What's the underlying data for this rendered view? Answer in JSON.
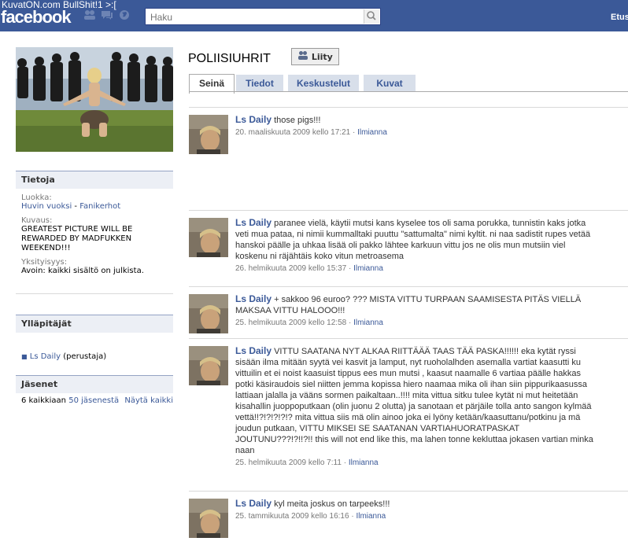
{
  "watermark": "KuvatON.com BullShit!1 >:[",
  "logo": "facebook",
  "search": {
    "placeholder": "Haku"
  },
  "top_right": "Etus",
  "group": {
    "title": "POLIISIUHRIT",
    "join_label": "Liity"
  },
  "tabs": [
    {
      "label": "Seinä"
    },
    {
      "label": "Tiedot"
    },
    {
      "label": "Keskustelut"
    },
    {
      "label": "Kuvat"
    }
  ],
  "info": {
    "header": "Tietoja",
    "category_label": "Luokka:",
    "category_value_1": "Huvin vuoksi",
    "category_sep": " - ",
    "category_value_2": "Fanikerhot",
    "desc_label": "Kuvaus:",
    "desc_value": "GREATEST PICTURE WILL BE REWARDED BY MADFUKKEN WEEKEND!!!",
    "privacy_label": "Yksityisyys:",
    "privacy_value": "Avoin: kaikki sisältö on julkista."
  },
  "admins": {
    "header": "Ylläpitäjät",
    "name": "Ls Daily",
    "role": "(perustaja)"
  },
  "members": {
    "header": "Jäsenet",
    "count_prefix": "6 kaikkiaan",
    "count_link": "50 jäsenestä",
    "show_all": "Näytä kaikki"
  },
  "posts": [
    {
      "author": "Ls Daily",
      "text": "those pigs!!!",
      "date": "20. maaliskuuta 2009 kello 17:21",
      "sep": " · ",
      "report": "Ilmianna"
    },
    {
      "author": "Ls Daily",
      "text": "paranee vielä, käytii mutsi kans kyselee tos oli sama porukka, tunnistin kaks jotka veti mua pataa, ni nimii kummalltaki puuttu \"sattumalta\" nimi kyltit. ni naa sadistit rupes vetää hanskoi päälle ja uhkaa lisää oli pakko lähtee karkuun vittu jos ne olis mun mutsiin viel koskenu ni räjähtäis koko vitun metroasema",
      "date": "26. helmikuuta 2009 kello 15:37",
      "sep": " · ",
      "report": "Ilmianna"
    },
    {
      "author": "Ls Daily",
      "text": "+ sakkoo 96 euroo? ??? MISTA VITTU TURPAAN SAAMISESTA PITÄS VIELLÄ MAKSAA VITTU HALOOO!!!",
      "date": "25. helmikuuta 2009 kello 12:58",
      "sep": " · ",
      "report": "Ilmianna"
    },
    {
      "author": "Ls Daily",
      "text": "VITTU SAATANA NYT ALKAA RIITTÄÄÄ TAAS TÄÄ PASKA!!!!!! eka kytät ryssi sisään ilma mitään syytä vei kasvit ja lamput, nyt ruoholalhden asemalla vartiat kaasutti ku vittuilin et ei noist kaasuist tippus ees mun mutsi , kaasut naamalle 6 vartiaa päälle hakkas potki käsiraudois siel niitten jemma kopissa hiero naamaa mika oli ihan siin pippurikaasussa lattiaan jalalla ja vääns sormen paikaltaan..!!!! mita vittua sitku tulee kytät ni mut heitetään kisahallin juoppoputkaan (olin juonu 2 olutta) ja sanotaan et pärjäile tolla anto sangon kylmää vettä!!?!?!?!?!? mita vittua siis mä olin ainoo joka ei lyöny ketään/kaasuttanu/potkinu ja mä joudun putkaan, VITTU MIKSEI SE SAATANAN VARTIAHUORATPASKAT JOUTUNU???!?!!?!! this will not end like this, ma lahen tonne kekluttaa jokasen vartian minka naan",
      "date": "25. helmikuuta 2009 kello 7:11",
      "sep": " · ",
      "report": "Ilmianna"
    },
    {
      "author": "Ls Daily",
      "text": "kyl meita joskus on tarpeeks!!!",
      "date": "25. tammikuuta 2009 kello 16:16",
      "sep": " · ",
      "report": "Ilmianna"
    }
  ]
}
